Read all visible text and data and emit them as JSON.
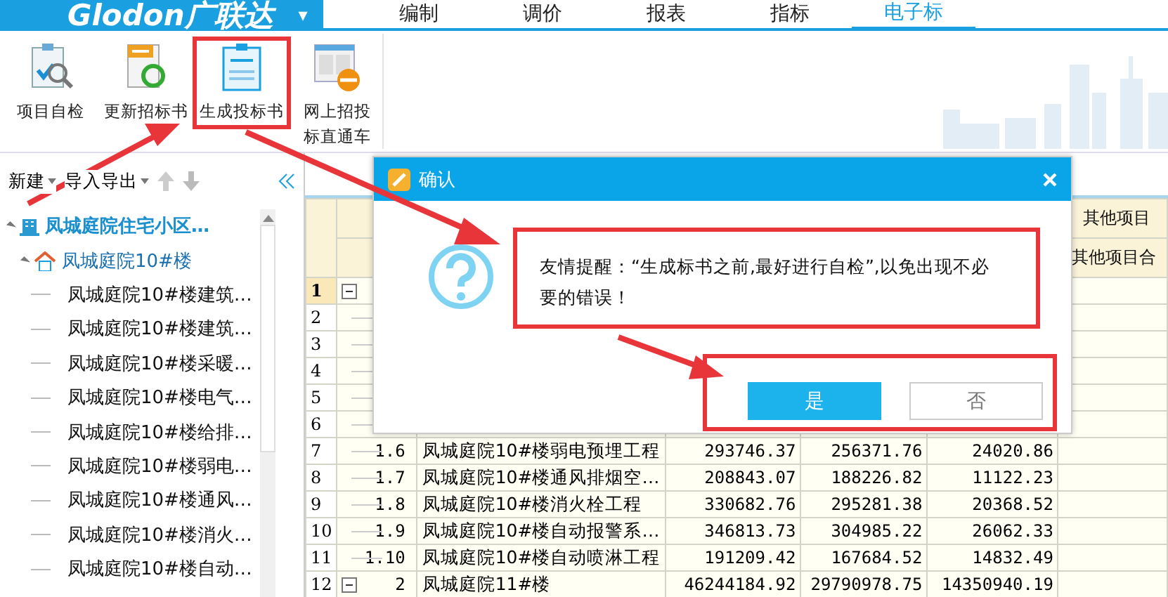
{
  "app": {
    "logo": "Glodon广联达",
    "logo_caret": "▾"
  },
  "menu_tabs": [
    {
      "label": "编制",
      "selected": false
    },
    {
      "label": "调价",
      "selected": false
    },
    {
      "label": "报表",
      "selected": false
    },
    {
      "label": "指标",
      "selected": false
    },
    {
      "label": "电子标",
      "selected": true
    }
  ],
  "ribbon": [
    {
      "label": "项目自检",
      "kind": "check"
    },
    {
      "label": "更新招标书",
      "kind": "refresh"
    },
    {
      "label": "生成投标书",
      "kind": "xml"
    },
    {
      "label": "网上招投标直通车",
      "kind": "web"
    }
  ],
  "sidebar": {
    "toolbar": [
      {
        "label": "新建",
        "dropdown": true
      },
      {
        "label": "导入导出",
        "dropdown": true
      }
    ],
    "tree": [
      {
        "label": "凤城庭院住宅小区…",
        "kind": "project",
        "expanded": true,
        "children": [
          {
            "label": "凤城庭院10#楼",
            "kind": "building",
            "expanded": true,
            "children": [
              {
                "label": "凤城庭院10#楼建筑…",
                "kind": "unit"
              },
              {
                "label": "凤城庭院10#楼建筑…",
                "kind": "unit"
              },
              {
                "label": "凤城庭院10#楼采暖…",
                "kind": "unit"
              },
              {
                "label": "凤城庭院10#楼电气…",
                "kind": "unit"
              },
              {
                "label": "凤城庭院10#楼给排…",
                "kind": "unit"
              },
              {
                "label": "凤城庭院10#楼弱电…",
                "kind": "unit"
              },
              {
                "label": "凤城庭院10#楼通风…",
                "kind": "unit"
              },
              {
                "label": "凤城庭院10#楼消火…",
                "kind": "unit"
              },
              {
                "label": "凤城庭院10#楼自动…",
                "kind": "unit"
              }
            ]
          }
        ]
      }
    ]
  },
  "grid": {
    "columns": [
      {
        "label": "其他项目",
        "sublabel": "其他项目合"
      }
    ],
    "rows": [
      {
        "number": "1",
        "selected": true,
        "collapsible": true
      },
      {
        "number": "2",
        "selected": false,
        "collapsible": false
      },
      {
        "number": "3",
        "selected": false,
        "collapsible": false
      },
      {
        "number": "4",
        "selected": false,
        "collapsible": false
      },
      {
        "number": "5",
        "selected": false,
        "collapsible": false
      },
      {
        "number": "6",
        "selected": false,
        "collapsible": false
      },
      {
        "number": "7",
        "selected": false,
        "collapsible": false,
        "code": "1.6",
        "name": "凤城庭院10#楼弱电预埋工程",
        "col_3": "293746.37",
        "col_4": "256371.76",
        "col_5": "24020.86"
      },
      {
        "number": "8",
        "selected": false,
        "collapsible": false,
        "code": "1.7",
        "name": "凤城庭院10#楼通风排烟空…",
        "col_3": "208843.07",
        "col_4": "188226.82",
        "col_5": "11122.23"
      },
      {
        "number": "9",
        "selected": false,
        "collapsible": false,
        "code": "1.8",
        "name": "凤城庭院10#楼消火栓工程",
        "col_3": "330682.76",
        "col_4": "295281.38",
        "col_5": "20368.52"
      },
      {
        "number": "10",
        "selected": false,
        "collapsible": false,
        "code": "1.9",
        "name": "凤城庭院10#楼自动报警系…",
        "col_3": "346813.73",
        "col_4": "304985.22",
        "col_5": "26062.33"
      },
      {
        "number": "11",
        "selected": false,
        "collapsible": false,
        "code": "1.10",
        "name": "凤城庭院10#楼自动喷淋工程",
        "col_3": "191209.42",
        "col_4": "167684.52",
        "col_5": "14832.49"
      },
      {
        "number": "12",
        "selected": false,
        "collapsible": true,
        "code": "2",
        "name": "凤城庭院11#楼",
        "col_3": "46244184.92",
        "col_4": "29790978.75",
        "col_5": "14350940.19"
      }
    ]
  },
  "dialog": {
    "title": "确认",
    "message": "友情提醒：“生成标书之前,最好进行自检”,以免出现不必要的错误！",
    "buttons": [
      {
        "label": "是",
        "selected": true
      },
      {
        "label": "否",
        "selected": false
      }
    ]
  }
}
